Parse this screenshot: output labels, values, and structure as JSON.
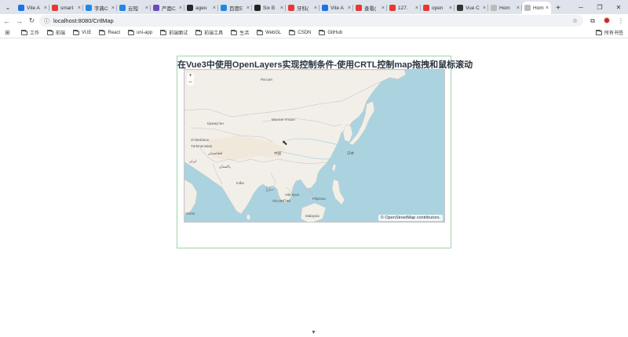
{
  "browser": {
    "tabs": [
      {
        "title": "Vite A",
        "color": "#1a73e8"
      },
      {
        "title": "smart",
        "color": "#e53935"
      },
      {
        "title": "字典C",
        "color": "#1e88e5"
      },
      {
        "title": "云短",
        "color": "#1e88e5"
      },
      {
        "title": "严面C",
        "color": "#6c4ab6"
      },
      {
        "title": "ageo",
        "color": "#24292f"
      },
      {
        "title": "百度E",
        "color": "#1e88e5"
      },
      {
        "title": "Six B",
        "color": "#222222"
      },
      {
        "title": "牙科(",
        "color": "#e53935"
      },
      {
        "title": "Vite A",
        "color": "#1a73e8"
      },
      {
        "title": "查看(",
        "color": "#e53935"
      },
      {
        "title": "127.",
        "color": "#e53935"
      },
      {
        "title": "open",
        "color": "#e53935"
      },
      {
        "title": "Vue C",
        "color": "#333333"
      },
      {
        "title": "Hom",
        "color": "#bbbbbb"
      },
      {
        "title": "Hom",
        "color": "#bbbbbb"
      }
    ],
    "active_tab_index": 15,
    "url": "localhost:8080/CrtlMap",
    "bookmarks": [
      "工作",
      "前端",
      "VUE",
      "React",
      "uni-app",
      "前端面试",
      "前端工具",
      "生活",
      "WebGL",
      "CSDN",
      "GitHub"
    ],
    "all_bookmarks": "所有书签"
  },
  "page": {
    "title": "在Vue3中使用OpenLayers实现控制条件-使用CRTL控制map拖拽和鼠标滚动",
    "zoom_in": "+",
    "zoom_out": "–",
    "attribution": "© OpenStreetMap contributors."
  },
  "map_labels": {
    "russia": "Россия",
    "kazakhstan": "Қазақстан",
    "mongolia": "Монгол Улсын",
    "uzbekistan": "O'zbekiston",
    "turkmenistan": "Türkmenistan",
    "china": "中国",
    "afghanistan": "افغانستان",
    "pakistan": "پاکستان",
    "iran": "ایران",
    "india": "India",
    "myanmar": "မြန်မာ",
    "thailand": "ประเทศไทย",
    "vietnam": "Việt Nam",
    "japan": "日本",
    "philippines": "Pilipinas",
    "malaysia": "Malaysia",
    "oman": "Oman"
  },
  "colors": {
    "water": "#aad3df",
    "land": "#f2efe9",
    "border": "#b9a8c2",
    "card_border": "#9ed4a9"
  }
}
